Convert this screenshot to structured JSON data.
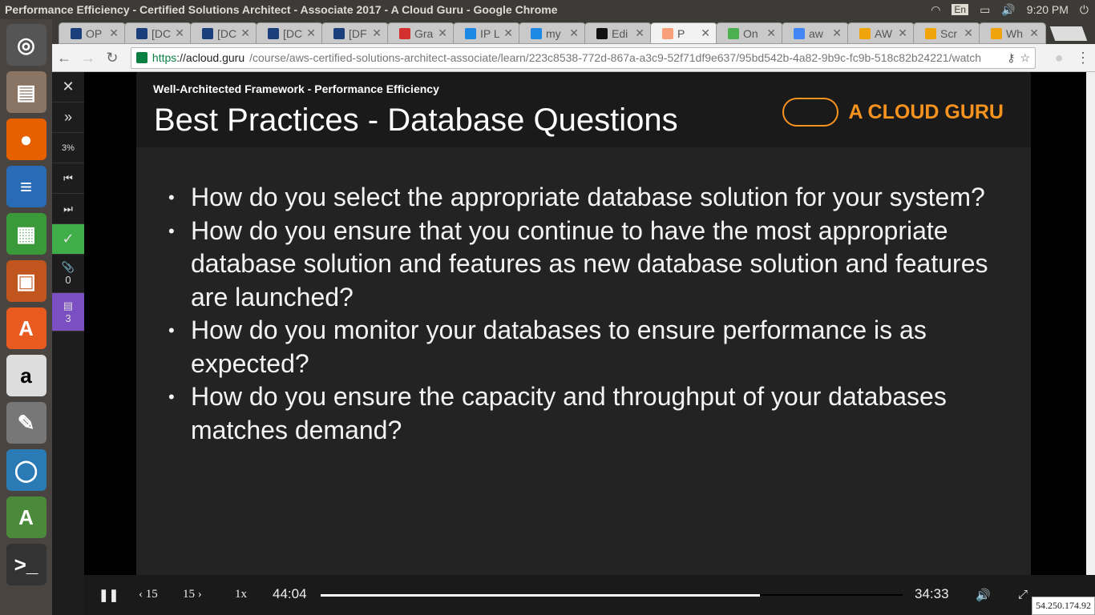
{
  "window": {
    "title": "Performance Efficiency - Certified Solutions Architect - Associate 2017 - A Cloud Guru - Google Chrome"
  },
  "tray": {
    "lang": "En",
    "time": "9:20 PM"
  },
  "tabs": [
    {
      "label": "OP",
      "color": "#1b3f7a"
    },
    {
      "label": "[DC",
      "color": "#1b3f7a"
    },
    {
      "label": "[DC",
      "color": "#1b3f7a"
    },
    {
      "label": "[DC",
      "color": "#1b3f7a"
    },
    {
      "label": "[DF",
      "color": "#1b3f7a"
    },
    {
      "label": "Gra",
      "color": "#d32f2f"
    },
    {
      "label": "IP L",
      "color": "#1e88e5"
    },
    {
      "label": "my",
      "color": "#1e88e5"
    },
    {
      "label": "Edi",
      "color": "#111"
    },
    {
      "label": "P",
      "color": "#f7a07a",
      "active": true
    },
    {
      "label": "On",
      "color": "#4caf50"
    },
    {
      "label": "aw",
      "color": "#4285f4"
    },
    {
      "label": "AW",
      "color": "#f0a30a"
    },
    {
      "label": "Scr",
      "color": "#f0a30a"
    },
    {
      "label": "Wh",
      "color": "#f0a30a"
    }
  ],
  "address": {
    "scheme": "https",
    "domain": "://acloud.guru",
    "path": "/course/aws-certified-solutions-architect-associate/learn/223c8538-772d-867a-a3c9-52f71df9e637/95bd542b-4a82-9b9c-fc9b-518c82b24221/watch"
  },
  "sidebar": {
    "close": "✕",
    "expand": "»",
    "progress": "3%",
    "prev": "⏮",
    "next": "⏭",
    "complete": "✓",
    "attachments_count": "0",
    "comments_count": "3"
  },
  "slide": {
    "subtitle": "Well-Architected Framework - Performance Efficiency",
    "title": "Best Practices - Database Questions",
    "logo": "A CLOUD GURU",
    "bullets": [
      "How do you select the appropriate database solution for your system?",
      "How do you ensure that you continue to have the most appropriate database solution and features as new database solution and features are launched?",
      "How do you monitor your databases to ensure performance is as expected?",
      "How do you ensure the capacity and throughput of your databases matches demand?"
    ]
  },
  "player": {
    "back": "‹ 15",
    "forward": "15 ›",
    "speed": "1x",
    "elapsed": "44:04",
    "remaining": "34:33",
    "progress": 0.755
  },
  "status": {
    "ip": "54.250.174.92"
  }
}
